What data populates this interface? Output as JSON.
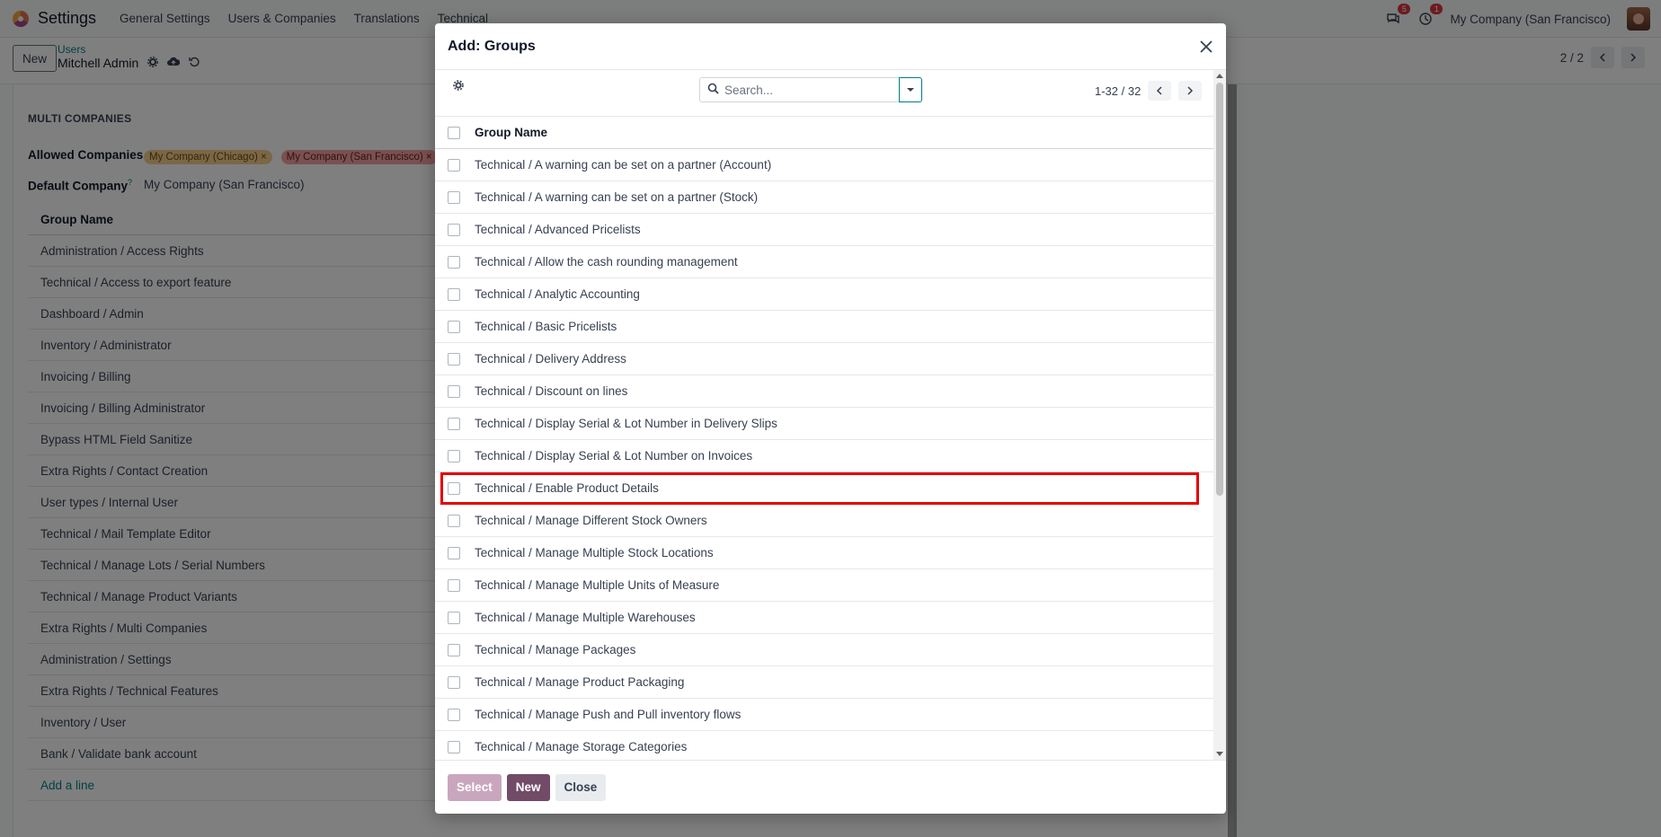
{
  "navbar": {
    "app_name": "Settings",
    "menus": [
      "General Settings",
      "Users & Companies",
      "Translations",
      "Technical"
    ],
    "chat_count": "5",
    "activity_count": "1",
    "company": "My Company (San Francisco)"
  },
  "control": {
    "new_label": "New",
    "breadcrumb_parent": "Users",
    "breadcrumb_current": "Mitchell Admin",
    "pager": "2 / 2"
  },
  "form": {
    "section_title": "MULTI COMPANIES",
    "allowed_companies_label": "Allowed Companies",
    "allowed_companies": [
      "My Company (Chicago)",
      "My Company (San Francisco)"
    ],
    "default_company_label": "Default Company",
    "default_company_help": "?",
    "default_company": "My Company (San Francisco)",
    "groups_header": "Group Name",
    "groups": [
      "Administration / Access Rights",
      "Technical / Access to export feature",
      "Dashboard / Admin",
      "Inventory / Administrator",
      "Invoicing / Billing",
      "Invoicing / Billing Administrator",
      "Bypass HTML Field Sanitize",
      "Extra Rights / Contact Creation",
      "User types / Internal User",
      "Technical / Mail Template Editor",
      "Technical / Manage Lots / Serial Numbers",
      "Technical / Manage Product Variants",
      "Extra Rights / Multi Companies",
      "Administration / Settings",
      "Extra Rights / Technical Features",
      "Inventory / User",
      "Bank / Validate bank account"
    ],
    "add_line": "Add a line"
  },
  "modal": {
    "title": "Add: Groups",
    "search_placeholder": "Search...",
    "pager": "1-32 / 32",
    "column_header": "Group Name",
    "rows": [
      "Technical / A warning can be set on a partner (Account)",
      "Technical / A warning can be set on a partner (Stock)",
      "Technical / Advanced Pricelists",
      "Technical / Allow the cash rounding management",
      "Technical / Analytic Accounting",
      "Technical / Basic Pricelists",
      "Technical / Delivery Address",
      "Technical / Discount on lines",
      "Technical / Display Serial & Lot Number in Delivery Slips",
      "Technical / Display Serial & Lot Number on Invoices",
      "Technical / Enable Product Details",
      "Technical / Manage Different Stock Owners",
      "Technical / Manage Multiple Stock Locations",
      "Technical / Manage Multiple Units of Measure",
      "Technical / Manage Multiple Warehouses",
      "Technical / Manage Packages",
      "Technical / Manage Product Packaging",
      "Technical / Manage Push and Pull inventory flows",
      "Technical / Manage Storage Categories"
    ],
    "select_label": "Select",
    "new_label": "New",
    "close_label": "Close"
  }
}
